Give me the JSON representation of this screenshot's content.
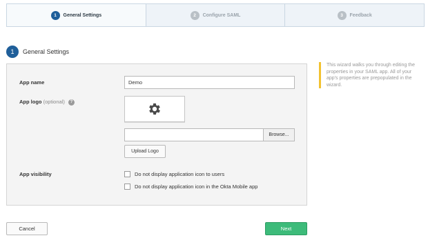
{
  "stepper": {
    "steps": [
      {
        "num": "1",
        "label": "General Settings",
        "active": true
      },
      {
        "num": "2",
        "label": "Configure SAML",
        "active": false
      },
      {
        "num": "3",
        "label": "Feedback",
        "active": false
      }
    ]
  },
  "section": {
    "num": "1",
    "title": "General Settings"
  },
  "form": {
    "app_name_label": "App name",
    "app_name_value": "Demo",
    "app_logo_label": "App logo",
    "app_logo_optional": "(optional)",
    "help_glyph": "?",
    "logo_icon": "gear-icon",
    "browse_label": "Browse...",
    "upload_logo_label": "Upload Logo",
    "app_visibility_label": "App visibility",
    "visibility_options": [
      {
        "label": "Do not display application icon to users",
        "checked": false
      },
      {
        "label": "Do not display application icon in the Okta Mobile app",
        "checked": false
      }
    ]
  },
  "hint": {
    "text": "This wizard walks you through editing the properties in your SAML app. All of your app's properties are prepopulated in the wizard."
  },
  "footer": {
    "cancel_label": "Cancel",
    "next_label": "Next"
  },
  "colors": {
    "accent": "#1f5f9a",
    "next_button": "#3dbb7a",
    "hint_border": "#f2c230"
  }
}
